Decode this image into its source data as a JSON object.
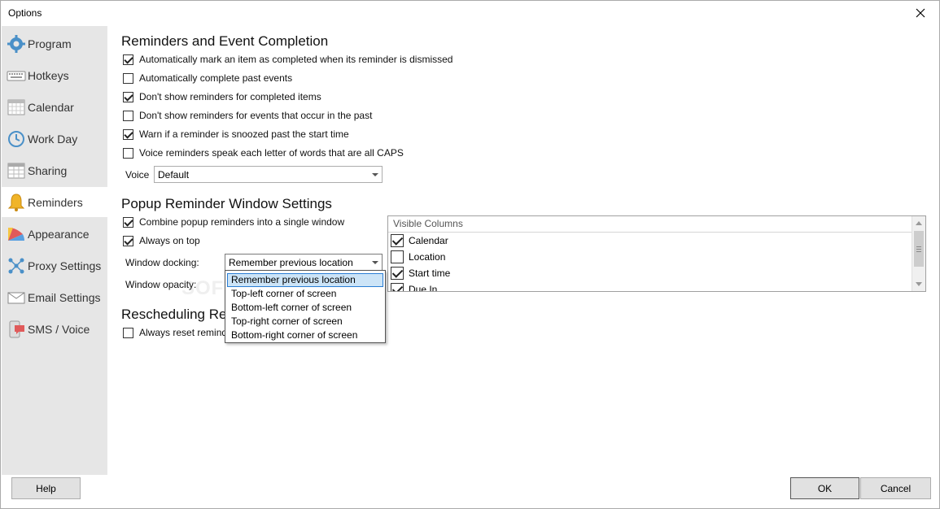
{
  "window": {
    "title": "Options"
  },
  "sidebar": {
    "items": [
      {
        "label": "Program",
        "icon": "gear-icon"
      },
      {
        "label": "Hotkeys",
        "icon": "keyboard-icon"
      },
      {
        "label": "Calendar",
        "icon": "calendar-icon"
      },
      {
        "label": "Work Day",
        "icon": "clock-icon"
      },
      {
        "label": "Sharing",
        "icon": "table-icon"
      },
      {
        "label": "Reminders",
        "icon": "bell-icon",
        "selected": true
      },
      {
        "label": "Appearance",
        "icon": "color-wheel-icon"
      },
      {
        "label": "Proxy Settings",
        "icon": "network-icon"
      },
      {
        "label": "Email Settings",
        "icon": "envelope-icon"
      },
      {
        "label": "SMS / Voice",
        "icon": "chat-bubble-icon"
      }
    ]
  },
  "reminders": {
    "title": "Reminders and Event Completion",
    "options": [
      {
        "label": "Automatically mark an item as completed when its reminder is dismissed",
        "checked": true
      },
      {
        "label": "Automatically complete past events",
        "checked": false
      },
      {
        "label": "Don't show reminders for completed items",
        "checked": true
      },
      {
        "label": "Don't show reminders for events that occur in the past",
        "checked": false
      },
      {
        "label": "Warn if a reminder is snoozed past the start time",
        "checked": true
      },
      {
        "label": "Voice reminders speak each letter of words that are all CAPS",
        "checked": false
      }
    ],
    "voice_label": "Voice",
    "voice_value": "Default"
  },
  "popup": {
    "title": "Popup Reminder Window Settings",
    "options": [
      {
        "label": "Combine popup reminders into a single window",
        "checked": true
      },
      {
        "label": "Always on top",
        "checked": true
      }
    ],
    "docking_label": "Window docking:",
    "docking_value": "Remember previous location",
    "opacity_label": "Window opacity:",
    "docking_options": [
      "Remember previous location",
      "Top-left corner of screen",
      "Bottom-left corner of screen",
      "Top-right corner of screen",
      "Bottom-right corner of screen"
    ],
    "columns_header": "Visible Columns",
    "columns": [
      {
        "label": "Calendar",
        "checked": true
      },
      {
        "label": "Location",
        "checked": false
      },
      {
        "label": "Start time",
        "checked": true
      },
      {
        "label": "Due In",
        "checked": true
      }
    ]
  },
  "rescheduling": {
    "title": "Rescheduling Rem",
    "option": {
      "label": "Always reset reminde",
      "checked": false
    }
  },
  "buttons": {
    "help": "Help",
    "ok": "OK",
    "cancel": "Cancel"
  },
  "watermark": "SOFTPEDIA"
}
